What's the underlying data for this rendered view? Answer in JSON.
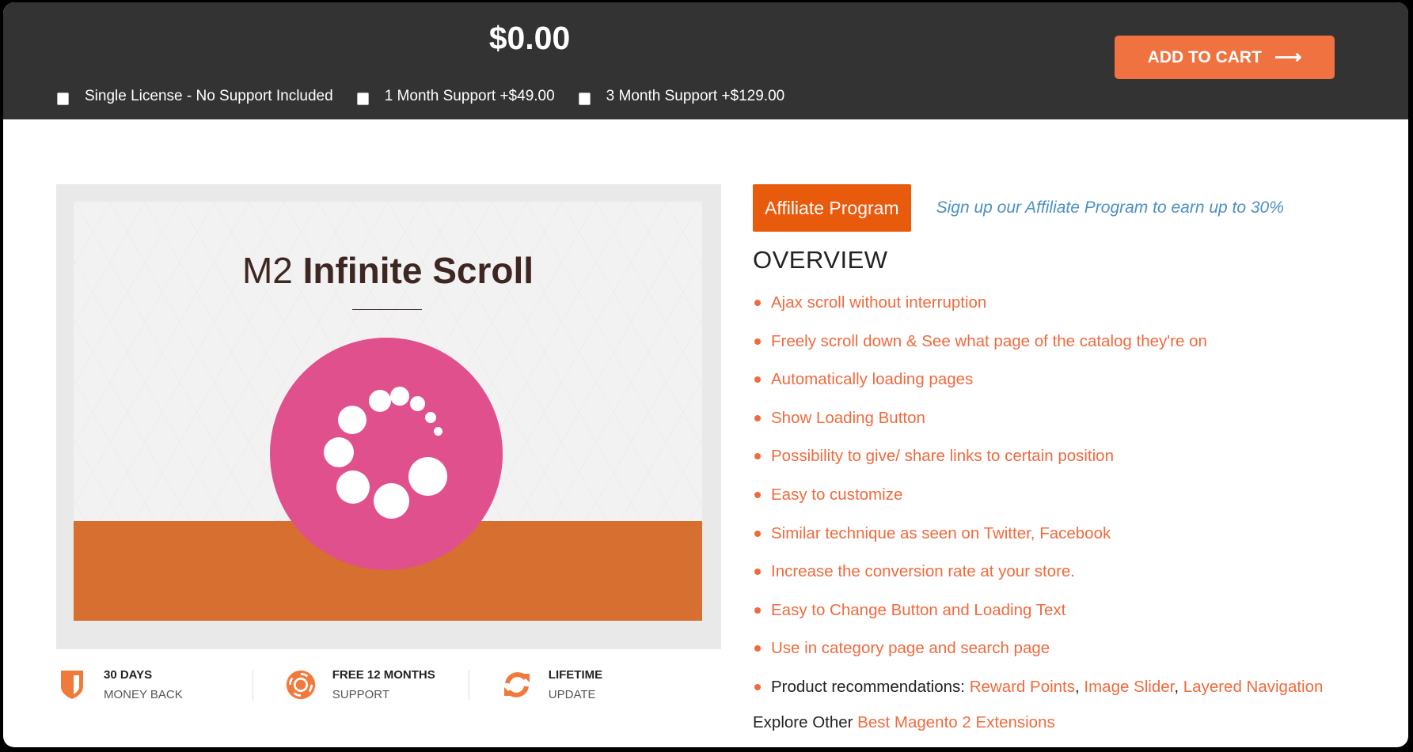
{
  "topbar": {
    "price": "$0.00",
    "add_to_cart_label": "ADD TO CART",
    "add_to_cart_icon": "arrow-right-icon",
    "options": [
      {
        "label": "Single License - No Support Included",
        "checked": false
      },
      {
        "label": "1 Month Support +$49.00",
        "checked": false
      },
      {
        "label": "3 Month Support +$129.00",
        "checked": false
      }
    ]
  },
  "product_image": {
    "title_light": "M2",
    "title_bold": "Infinite Scroll",
    "icon": "loading-spinner-icon"
  },
  "features": [
    {
      "icon": "shield-icon",
      "title": "30 DAYS",
      "subtitle": "MONEY BACK"
    },
    {
      "icon": "lifebuoy-icon",
      "title": "FREE 12 MONTHS",
      "subtitle": "SUPPORT"
    },
    {
      "icon": "refresh-icon",
      "title": "LIFETIME",
      "subtitle": "UPDATE"
    }
  ],
  "affiliate": {
    "button_label": "Affiliate Program",
    "link_text": "Sign up our Affiliate Program to earn up to 30%"
  },
  "overview": {
    "heading": "OVERVIEW",
    "bullets": [
      "Ajax scroll without interruption",
      "Freely scroll down & See what page of the catalog they're on",
      "Automatically loading pages",
      "Show Loading Button",
      "Possibility to give/ share links to certain position",
      "Easy to customize",
      "Similar technique as seen on Twitter, Facebook",
      "Increase the conversion rate at your store.",
      "Easy to Change Button and Loading Text",
      "Use in category page and search page"
    ],
    "recommendations_label": "Product recommendations: ",
    "recommendations": [
      "Reward Points",
      "Image Slider",
      "Layered Navigation"
    ],
    "explore_label": "Explore Other ",
    "explore_link": "Best Magento 2 Extensions"
  },
  "colors": {
    "topbar_bg": "#333333",
    "accent_orange": "#f07241",
    "affiliate_orange": "#e85a0c",
    "link_blue": "#4a90c2",
    "banner_pink": "#e0508c",
    "banner_orange": "#d66f30"
  }
}
